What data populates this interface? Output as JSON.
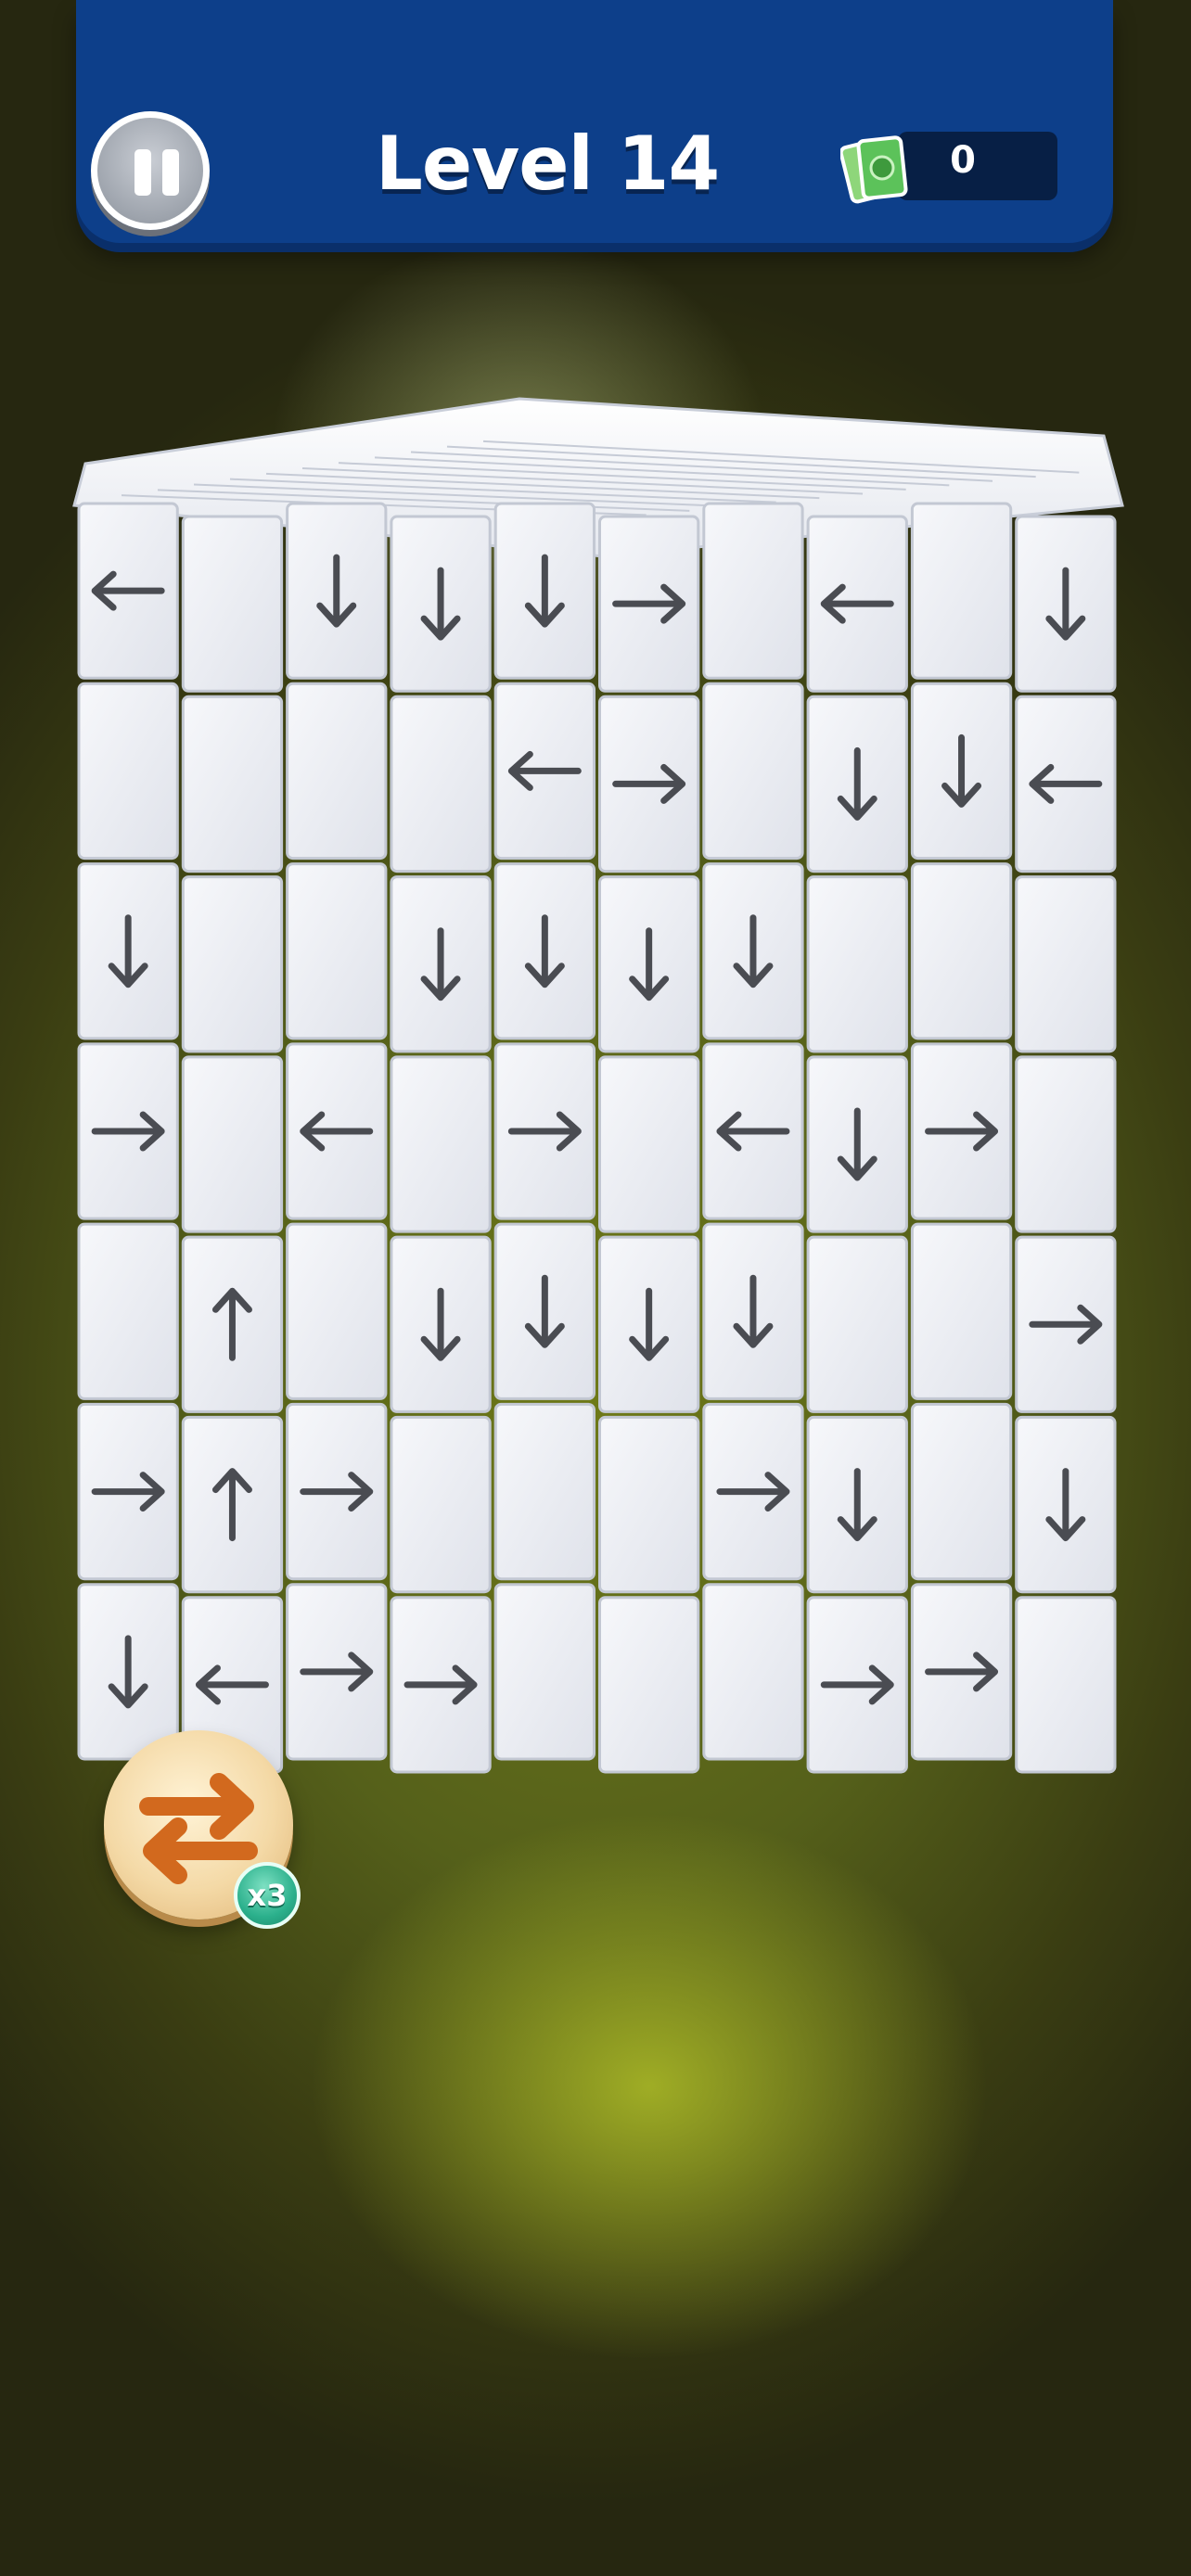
{
  "hud": {
    "level_label": "Level 14",
    "cash_value": "0",
    "cash_icon": "cash-stack-icon",
    "pause_icon": "pause-icon"
  },
  "booster": {
    "icon": "swap-arrows-icon",
    "count_label": "x3"
  },
  "colors": {
    "hud_blue": "#0d3f8a",
    "tile_white": "#f2f4f8",
    "arrow_gray": "#4a4c52",
    "booster_orange": "#d2691e",
    "badge_teal": "#2bb08c"
  },
  "board": {
    "columns": [
      {
        "name": "col-1",
        "tiles": [
          "left",
          "blank",
          "down",
          "right",
          "blank",
          "right",
          "down"
        ]
      },
      {
        "name": "col-2",
        "tiles": [
          "blank",
          "blank",
          "blank",
          "blank",
          "up",
          "up",
          "left"
        ]
      },
      {
        "name": "col-3",
        "tiles": [
          "down",
          "blank",
          "blank",
          "left",
          "blank",
          "right",
          "right"
        ]
      },
      {
        "name": "col-4",
        "tiles": [
          "down",
          "blank",
          "down",
          "blank",
          "down",
          "blank",
          "right"
        ]
      },
      {
        "name": "col-5",
        "tiles": [
          "down",
          "left",
          "down",
          "right",
          "down",
          "blank",
          "blank"
        ]
      },
      {
        "name": "col-6",
        "tiles": [
          "right",
          "right",
          "down",
          "blank",
          "down",
          "blank",
          "blank"
        ]
      },
      {
        "name": "col-7",
        "tiles": [
          "blank",
          "blank",
          "down",
          "left",
          "down",
          "right",
          "blank"
        ]
      },
      {
        "name": "col-8",
        "tiles": [
          "left",
          "down",
          "blank",
          "down",
          "blank",
          "down",
          "right"
        ]
      },
      {
        "name": "col-9",
        "tiles": [
          "blank",
          "down",
          "blank",
          "right",
          "blank",
          "blank",
          "right"
        ]
      },
      {
        "name": "col-10",
        "tiles": [
          "down",
          "left",
          "blank",
          "blank",
          "right",
          "down",
          "blank"
        ]
      }
    ]
  }
}
